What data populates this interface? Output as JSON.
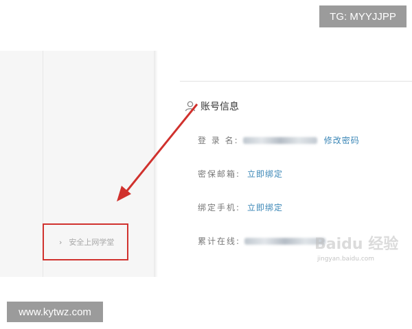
{
  "overlay": {
    "top_tag": "TG: MYYJJPP",
    "bottom_tag": "www.kytwz.com"
  },
  "sidebar": {
    "highlighted_item_label": "安全上网学堂"
  },
  "account_info": {
    "section_title": "账号信息",
    "login_name_label": "登 录 名:",
    "change_password_link": "修改密码",
    "security_email_label": "密保邮箱:",
    "bind_now_link_1": "立即绑定",
    "bound_phone_label": "绑定手机:",
    "bind_now_link_2": "立即绑定",
    "online_time_label": "累计在线:"
  },
  "watermark": {
    "brand": "Baidu 经验",
    "url": "jingyan.baidu.com"
  },
  "colors": {
    "highlight_border": "#d0312d",
    "arrow": "#d0312d",
    "link": "#3a86b6",
    "tag_bg": "#9b9b9b"
  }
}
